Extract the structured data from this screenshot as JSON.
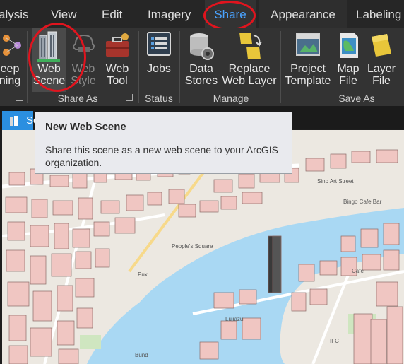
{
  "tabs": [
    {
      "label": "alysis"
    },
    {
      "label": "View"
    },
    {
      "label": "Edit"
    },
    {
      "label": "Imagery"
    },
    {
      "label": "Share"
    },
    {
      "label": "Appearance"
    },
    {
      "label": "Labeling"
    }
  ],
  "active_tab": "Share",
  "ribbon": {
    "partial_button": {
      "line1": "eep",
      "line2": "ning"
    },
    "web_scene": {
      "line1": "Web",
      "line2": "Scene"
    },
    "web_style": {
      "line1": "Web",
      "line2": "Style"
    },
    "web_tool": {
      "line1": "Web",
      "line2": "Tool"
    },
    "jobs": {
      "line1": "Jobs"
    },
    "data_stores": {
      "line1": "Data",
      "line2": "Stores"
    },
    "replace_web_layer": {
      "line1": "Replace",
      "line2": "Web Layer"
    },
    "project_template": {
      "line1": "Project",
      "line2": "Template"
    },
    "map_file": {
      "line1": "Map",
      "line2": "File"
    },
    "layer_file": {
      "line1": "Layer",
      "line2": "File"
    },
    "groups": {
      "share_as": "Share As",
      "status": "Status",
      "manage": "Manage",
      "save_as": "Save As"
    }
  },
  "view_tab": {
    "label": "Sc"
  },
  "tooltip": {
    "title": "New Web Scene",
    "body": "Share this scene as a new web scene to your ArcGIS organization."
  },
  "map_labels": {
    "sino_art": "Sino Art Street",
    "bingo": "Bingo Cafe Bar",
    "people": "People's Square",
    "puxi": "Puxi",
    "lujiazui": "Lujiazui",
    "bund": "Bund",
    "cafe": "Cafe",
    "ifc": "IFC"
  },
  "colors": {
    "accent": "#4aa3ff",
    "annotation": "#e0141e",
    "water": "#a9d8f3",
    "building": "#f0c6c2"
  }
}
